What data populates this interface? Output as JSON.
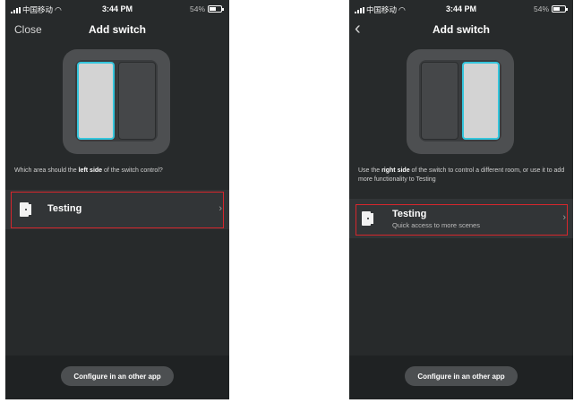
{
  "left_screen": {
    "status": {
      "carrier": "中国移动",
      "time": "3:44 PM",
      "battery": "54%"
    },
    "nav": {
      "close_label": "Close",
      "title": "Add switch"
    },
    "prompt": {
      "pre": "Which area should the ",
      "bold": "left side",
      "post": " of the switch control?"
    },
    "room": {
      "title": "Testing"
    },
    "configure_label": "Configure in an other app"
  },
  "right_screen": {
    "status": {
      "carrier": "中国移动",
      "time": "3:44 PM",
      "battery": "54%"
    },
    "nav": {
      "title": "Add switch"
    },
    "prompt": {
      "pre": "Use the ",
      "bold": "right side",
      "post": " of the switch to control a different room, or use it to add more functionality to Testing"
    },
    "room": {
      "title": "Testing",
      "subtitle": "Quick access to more scenes"
    },
    "configure_label": "Configure in an other app"
  },
  "colors": {
    "background": "#272a2b",
    "active_outline": "#34c5dc",
    "highlight_box": "#d6262c"
  },
  "icons": [
    "signal-icon",
    "wifi-icon",
    "battery-icon",
    "back-chevron-icon",
    "door-icon",
    "chevron-right-icon"
  ]
}
